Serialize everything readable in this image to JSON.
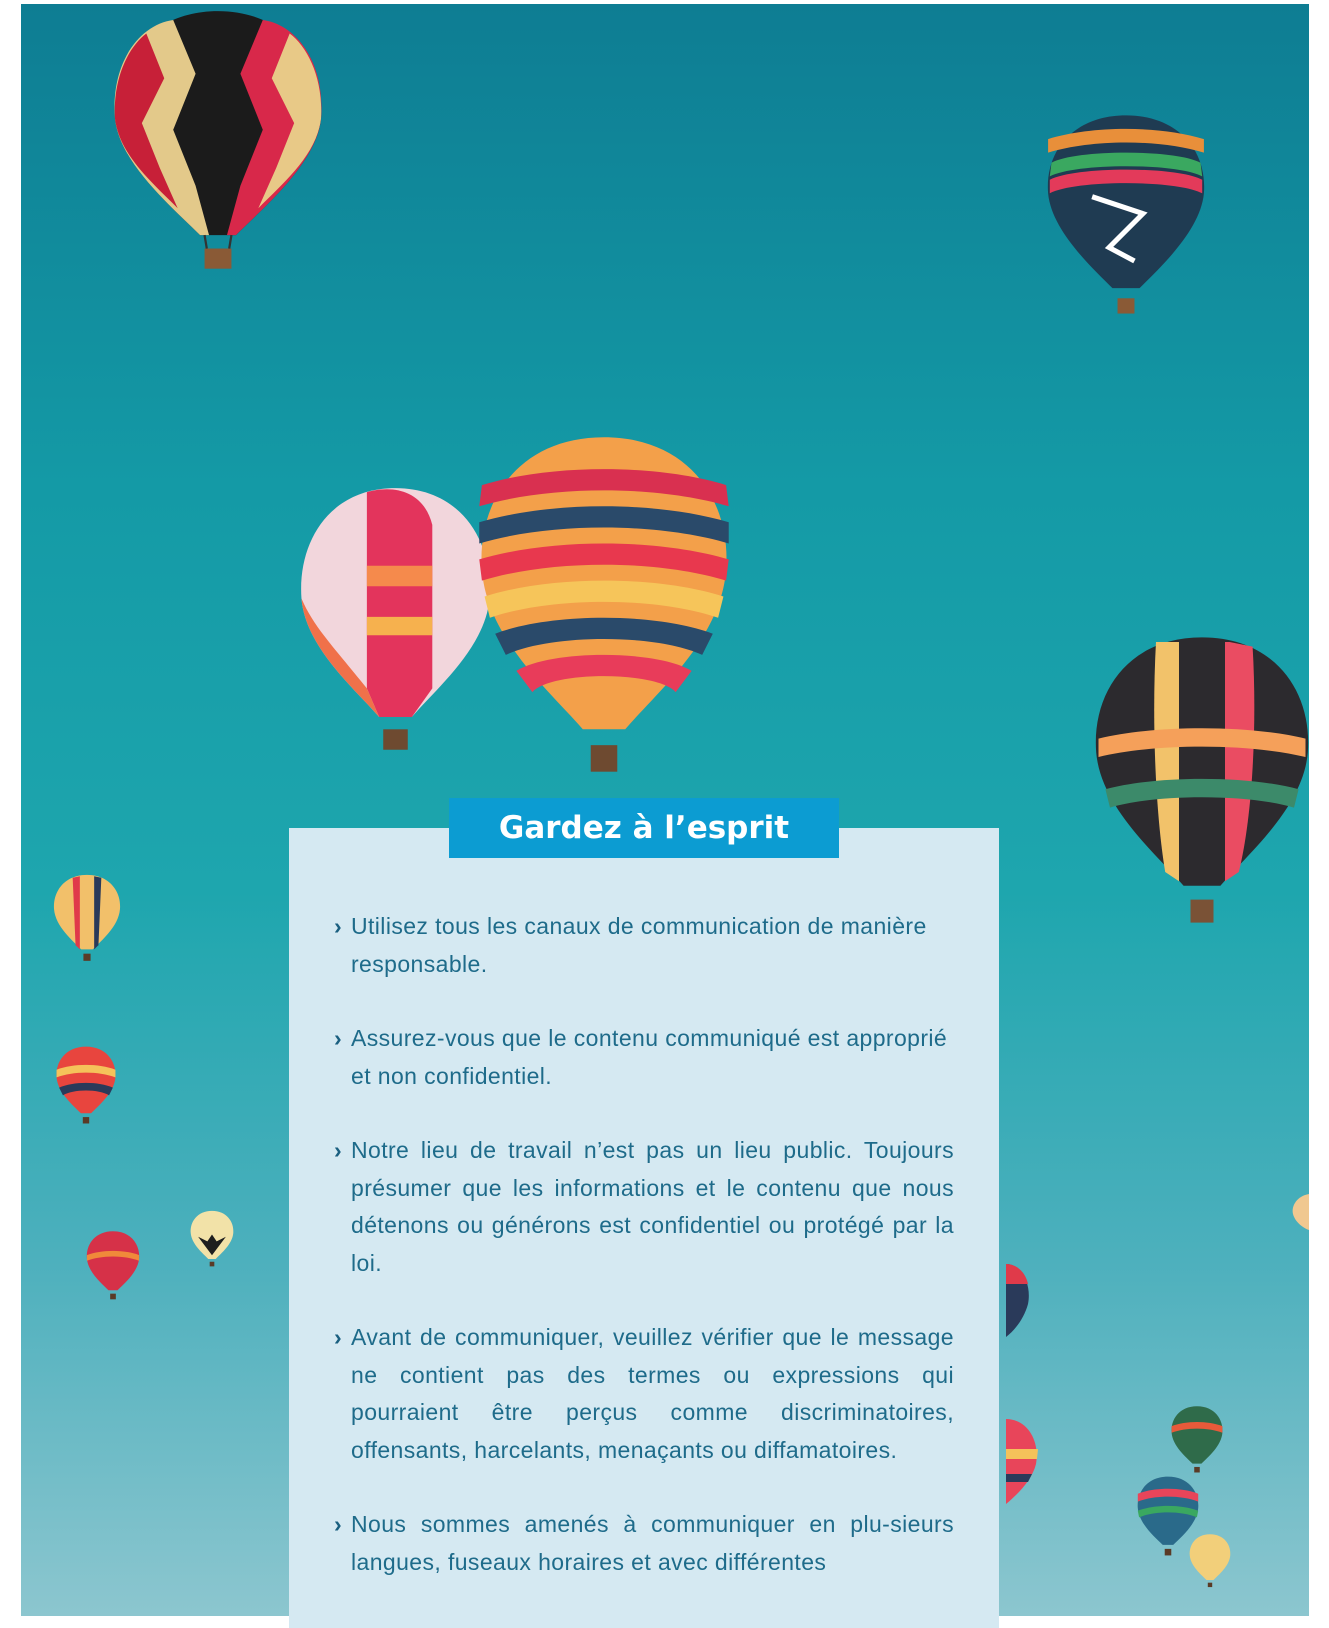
{
  "box": {
    "title": "Gardez à l’esprit",
    "items": [
      {
        "text": "Utilisez tous les canaux de communication de manière responsable.",
        "justify": false
      },
      {
        "text": "Assurez-vous que le contenu communiqué est approprié et non confidentiel.",
        "justify": false
      },
      {
        "text": "Notre lieu de travail n’est pas un lieu public. Toujours présumer que les informations et le contenu que nous détenons ou générons est confidentiel ou protégé par la loi.",
        "justify": true
      },
      {
        "text": "Avant de communiquer, veuillez vérifier que le message ne contient pas des termes ou expressions qui pourraient être perçus comme discriminatoires, offensants, harcelants, menaçants ou diffamatoires.",
        "justify": true
      },
      {
        "text": "Nous sommes amenés à communiquer en plu-sieurs langues, fuseaux horaires et avec différentes",
        "justify": true
      }
    ]
  },
  "colors": {
    "sky_top": "#0e7d93",
    "sky_bottom": "#8cc6cf",
    "card_bg": "#d5e9f2",
    "title_bg": "#0c9cd2",
    "text": "#1e6b8a"
  }
}
